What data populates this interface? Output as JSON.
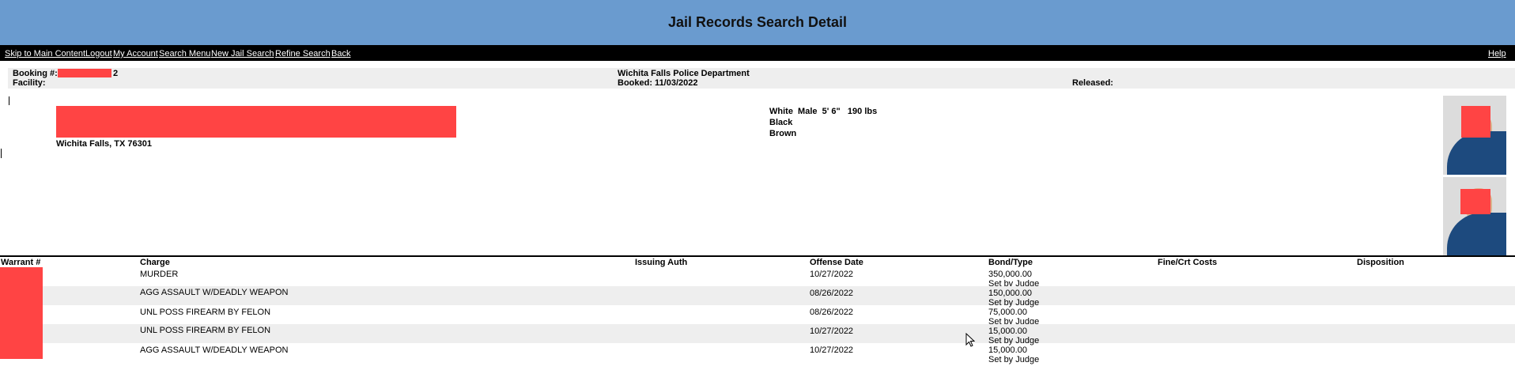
{
  "header": {
    "title": "Jail Records Search Detail"
  },
  "nav": {
    "links": [
      "Skip to Main Content",
      "Logout",
      "My Account",
      "Search Menu",
      "New Jail Search",
      "Refine Search",
      "Back"
    ],
    "help": "Help"
  },
  "booking": {
    "booking_label": "Booking #:",
    "booking_suffix": "2",
    "facility_label": "Facility:",
    "agency": "Wichita Falls Police Department",
    "booked": "Booked: 11/03/2022",
    "released_label": "Released:"
  },
  "inmate": {
    "city_line": "Wichita Falls, TX 76301",
    "race_sex_height_weight": "White  Male  5' 6\"   190 lbs",
    "hair": "Black",
    "eyes": "Brown"
  },
  "charges": {
    "columns": [
      "Warrant #",
      "Charge",
      "Issuing Auth",
      "Offense Date",
      "Bond/Type",
      "Fine/Crt Costs",
      "Disposition"
    ],
    "rows": [
      {
        "charge": "MURDER",
        "offense_date": "10/27/2022",
        "bond": "350,000.00",
        "bond_type": "Set by Judge"
      },
      {
        "charge": "AGG ASSAULT W/DEADLY WEAPON",
        "offense_date": "08/26/2022",
        "bond": "150,000.00",
        "bond_type": "Set by Judge"
      },
      {
        "charge": "UNL POSS FIREARM BY FELON",
        "offense_date": "08/26/2022",
        "bond": "75,000.00",
        "bond_type": "Set by Judge"
      },
      {
        "charge": "UNL POSS FIREARM BY FELON",
        "offense_date": "10/27/2022",
        "bond": "15,000.00",
        "bond_type": "Set by Judge"
      },
      {
        "charge": "AGG ASSAULT W/DEADLY WEAPON",
        "offense_date": "10/27/2022",
        "bond": "15,000.00",
        "bond_type": "Set by Judge"
      }
    ]
  },
  "colors": {
    "header_bg": "#6a9bcf",
    "nav_bg": "#000000",
    "row_alt": "#eeeeee",
    "redaction": "#ff4444"
  }
}
